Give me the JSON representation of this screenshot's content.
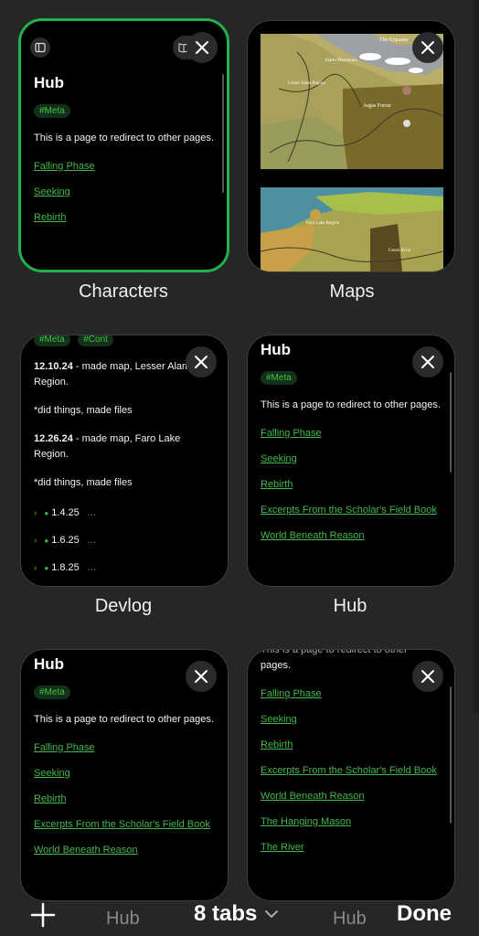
{
  "tabs": [
    {
      "label": "Characters",
      "title": "Hub",
      "tags": [
        "#Meta"
      ],
      "text": "This is a page to redirect to other pages.",
      "links": [
        "Falling Phase",
        "Seeking",
        "Rebirth"
      ]
    },
    {
      "label": "Maps",
      "map_labels": [
        "The Expanse",
        "Alarm Mountains",
        "Lesser Alam Region",
        "Argas Forest",
        "Faro Lake Region",
        "Green River"
      ]
    },
    {
      "label": "Devlog",
      "tags": [
        "#Meta",
        "#Cont"
      ],
      "entries": [
        {
          "date": "12.10.24",
          "text": " - made map, Lesser Alam Region."
        },
        {
          "note": "*did things, made files"
        },
        {
          "date": "12.26.24",
          "text": " - made map, Faro Lake Region."
        },
        {
          "note": "*did things, made files"
        }
      ],
      "toggles": [
        "1.4.25",
        "1.6.25",
        "1.8.25"
      ]
    },
    {
      "label": "Hub",
      "title": "Hub",
      "tags": [
        "#Meta"
      ],
      "text": "This is a page to redirect to other pages.",
      "links": [
        "Falling Phase",
        "Seeking",
        "Rebirth",
        "Excerpts From the Scholar's Field Book",
        "World Beneath Reason"
      ]
    },
    {
      "title": "Hub",
      "tags": [
        "#Meta"
      ],
      "text": "This is a page to redirect to other pages.",
      "links": [
        "Falling Phase",
        "Seeking",
        "Rebirth",
        "Excerpts From the Scholar's Field Book",
        "World Beneath Reason"
      ]
    },
    {
      "text_partial_top": "This is a page to redirect to other",
      "text_partial": "pages.",
      "links": [
        "Falling Phase",
        "Seeking",
        "Rebirth",
        "Excerpts From the Scholar's Field Book",
        "World Beneath Reason",
        "The Hanging Mason",
        "The River"
      ]
    }
  ],
  "bottom_bar": {
    "left_label": "Hub",
    "tabs_count": "8 tabs",
    "right_label": "Hub",
    "done": "Done"
  },
  "colors": {
    "active_border": "#22b14c",
    "link": "#42b84a",
    "background": "#262626"
  }
}
